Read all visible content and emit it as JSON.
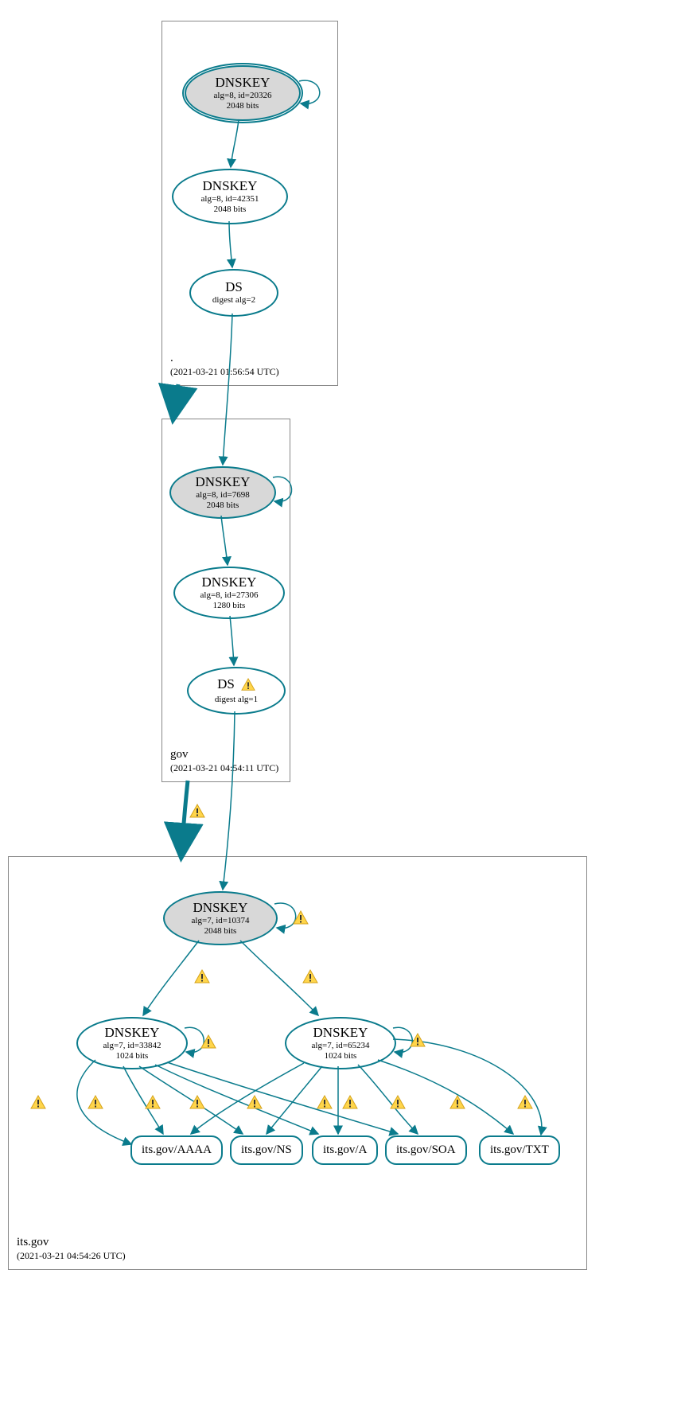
{
  "zones": [
    {
      "name": ".",
      "timestamp": "(2021-03-21 01:56:54 UTC)"
    },
    {
      "name": "gov",
      "timestamp": "(2021-03-21 04:54:11 UTC)"
    },
    {
      "name": "its.gov",
      "timestamp": "(2021-03-21 04:54:26 UTC)"
    }
  ],
  "nodes": {
    "root_ksk": {
      "title": "DNSKEY",
      "line1": "alg=8, id=20326",
      "line2": "2048 bits"
    },
    "root_zsk": {
      "title": "DNSKEY",
      "line1": "alg=8, id=42351",
      "line2": "2048 bits"
    },
    "root_ds": {
      "title": "DS",
      "line1": "digest alg=2"
    },
    "gov_ksk": {
      "title": "DNSKEY",
      "line1": "alg=8, id=7698",
      "line2": "2048 bits"
    },
    "gov_zsk": {
      "title": "DNSKEY",
      "line1": "alg=8, id=27306",
      "line2": "1280 bits"
    },
    "gov_ds": {
      "title": "DS",
      "line1": "digest alg=1"
    },
    "its_ksk": {
      "title": "DNSKEY",
      "line1": "alg=7, id=10374",
      "line2": "2048 bits"
    },
    "its_zsk1": {
      "title": "DNSKEY",
      "line1": "alg=7, id=33842",
      "line2": "1024 bits"
    },
    "its_zsk2": {
      "title": "DNSKEY",
      "line1": "alg=7, id=65234",
      "line2": "1024 bits"
    }
  },
  "rrsets": {
    "aaaa": "its.gov/AAAA",
    "ns": "its.gov/NS",
    "a": "its.gov/A",
    "soa": "its.gov/SOA",
    "txt": "its.gov/TXT"
  }
}
